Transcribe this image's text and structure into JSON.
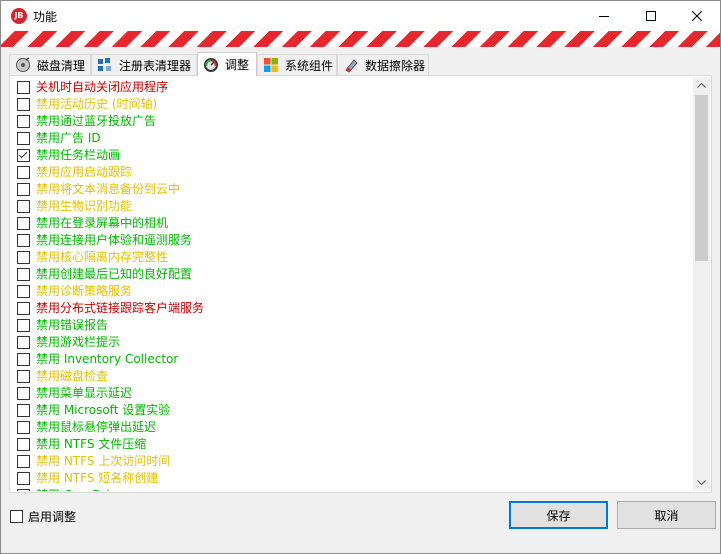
{
  "window": {
    "title": "功能",
    "app_icon_text": "JB"
  },
  "tabs": [
    {
      "label": "磁盘清理",
      "icon": "disk-cleanup-icon",
      "active": false
    },
    {
      "label": "注册表清理器",
      "icon": "registry-cleaner-icon",
      "active": false
    },
    {
      "label": "调整",
      "icon": "tweaks-gauge-icon",
      "active": true
    },
    {
      "label": "系统组件",
      "icon": "windows-logo-icon",
      "active": false
    },
    {
      "label": "数据擦除器",
      "icon": "eraser-icon",
      "active": false
    }
  ],
  "colors": {
    "red": "#cc0000",
    "yellow": "#e3c200",
    "green": "#00b900",
    "stripe": "#e8262c",
    "accent": "#0078d7"
  },
  "tweaks": [
    {
      "label": "关机时自动关闭应用程序",
      "color": "red",
      "checked": false
    },
    {
      "label": "禁用活动历史 (时间轴)",
      "color": "yellow",
      "checked": false
    },
    {
      "label": "禁用通过蓝牙投放广告",
      "color": "green",
      "checked": false
    },
    {
      "label": "禁用广告 ID",
      "color": "green",
      "checked": false
    },
    {
      "label": "禁用任务栏动画",
      "color": "green",
      "checked": true
    },
    {
      "label": "禁用应用启动跟踪",
      "color": "yellow",
      "checked": false
    },
    {
      "label": "禁用将文本消息备份到云中",
      "color": "yellow",
      "checked": false
    },
    {
      "label": "禁用生物识别功能",
      "color": "yellow",
      "checked": false
    },
    {
      "label": "禁用在登录屏幕中的相机",
      "color": "green",
      "checked": false
    },
    {
      "label": "禁用连接用户体验和遥测服务",
      "color": "green",
      "checked": false
    },
    {
      "label": "禁用核心隔离内存完整性",
      "color": "yellow",
      "checked": false
    },
    {
      "label": "禁用创建最后已知的良好配置",
      "color": "green",
      "checked": false
    },
    {
      "label": "禁用诊断策略服务",
      "color": "yellow",
      "checked": false
    },
    {
      "label": "禁用分布式链接跟踪客户端服务",
      "color": "red",
      "checked": false
    },
    {
      "label": "禁用错误报告",
      "color": "green",
      "checked": false
    },
    {
      "label": "禁用游戏栏提示",
      "color": "green",
      "checked": false
    },
    {
      "label": "禁用 Inventory Collector",
      "color": "green",
      "checked": false
    },
    {
      "label": "禁用磁盘检查",
      "color": "yellow",
      "checked": false
    },
    {
      "label": "禁用菜单显示延迟",
      "color": "green",
      "checked": false
    },
    {
      "label": "禁用 Microsoft 设置实验",
      "color": "green",
      "checked": false
    },
    {
      "label": "禁用鼠标悬停弹出延迟",
      "color": "green",
      "checked": false
    },
    {
      "label": "禁用 NTFS 文件压缩",
      "color": "green",
      "checked": false
    },
    {
      "label": "禁用 NTFS 上次访问时间",
      "color": "yellow",
      "checked": false
    },
    {
      "label": "禁用 NTFS 短名称创建",
      "color": "yellow",
      "checked": false
    },
    {
      "label": "禁用 One Drive",
      "color": "green",
      "checked": false
    }
  ],
  "footer": {
    "enable_label": "启用调整",
    "enable_checked": false,
    "save_label": "保存",
    "cancel_label": "取消"
  }
}
